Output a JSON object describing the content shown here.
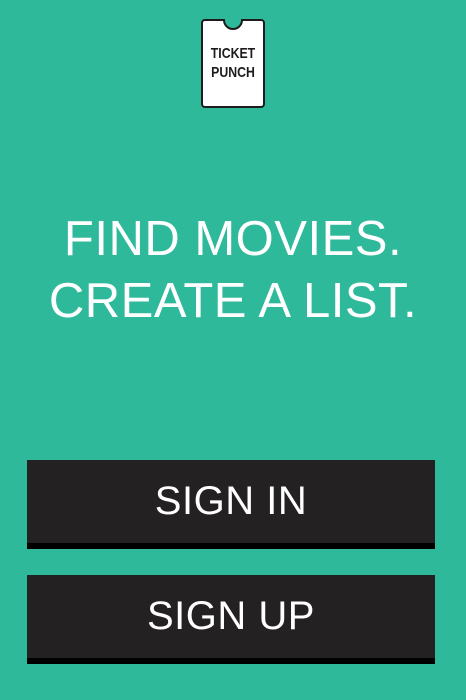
{
  "logo": {
    "line1": "TICKET",
    "line2": "PUNCH"
  },
  "headline": {
    "line1": "FIND MOVIES.",
    "line2": "CREATE A LIST."
  },
  "buttons": {
    "sign_in": "SIGN IN",
    "sign_up": "SIGN UP"
  },
  "colors": {
    "background": "#2fb99b",
    "button": "#242122",
    "button_shadow": "#000000",
    "text": "#ffffff"
  }
}
